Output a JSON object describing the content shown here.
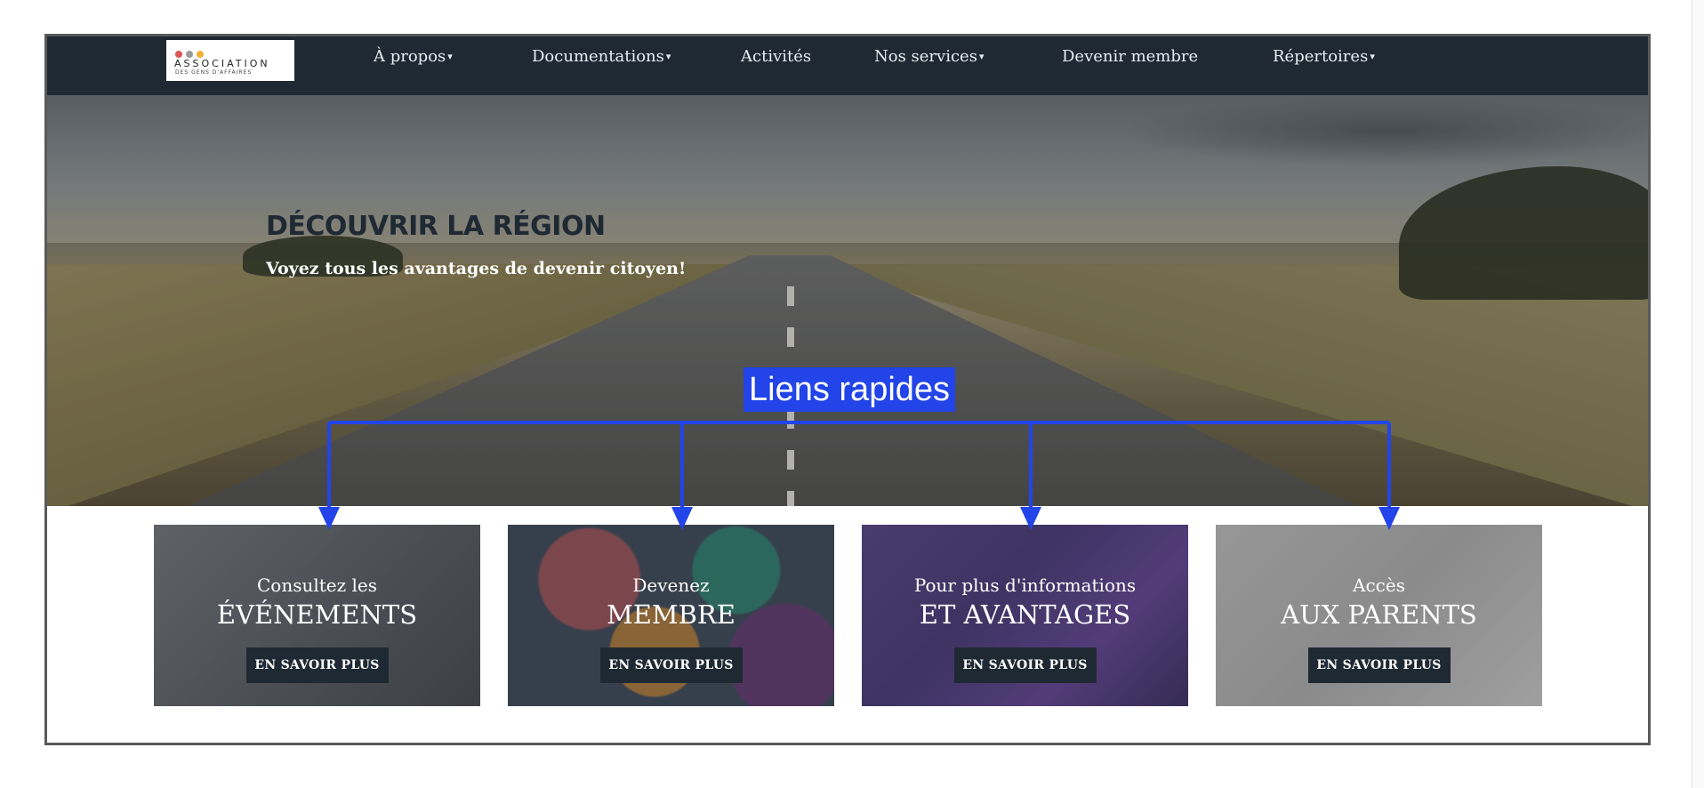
{
  "logo": {
    "line1": "ASSOCIATION",
    "line2": "DES GENS D'AFFAIRES",
    "dot_colors": [
      "#e05555",
      "#9a9a9a",
      "#f0b030"
    ]
  },
  "nav": {
    "items": [
      {
        "label": "À propos",
        "has_caret": true
      },
      {
        "label": "Documentations",
        "has_caret": true
      },
      {
        "label": "Activités",
        "has_caret": false
      },
      {
        "label": "Nos services",
        "has_caret": true
      },
      {
        "label": "Devenir membre",
        "has_caret": false
      },
      {
        "label": "Répertoires",
        "has_caret": true
      }
    ],
    "caret": "▾"
  },
  "hero": {
    "title": "DÉCOUVRIR LA RÉGION",
    "subtitle": "Voyez tous les avantages de devenir citoyen!"
  },
  "annotation": {
    "label": "Liens rapides",
    "color": "#2244e8"
  },
  "cards": [
    {
      "small": "Consultez les",
      "big": "ÉVÉNEMENTS",
      "button": "EN SAVOIR PLUS"
    },
    {
      "small": "Devenez",
      "big": "MEMBRE",
      "button": "EN SAVOIR PLUS"
    },
    {
      "small": "Pour plus d'informations",
      "big": "ET AVANTAGES",
      "button": "EN SAVOIR PLUS"
    },
    {
      "small": "Accès",
      "big": "AUX PARENTS",
      "button": "EN SAVOIR PLUS"
    }
  ],
  "colors": {
    "navbar": "#1f2933",
    "button": "#1f2933",
    "accent": "#2244e8"
  }
}
